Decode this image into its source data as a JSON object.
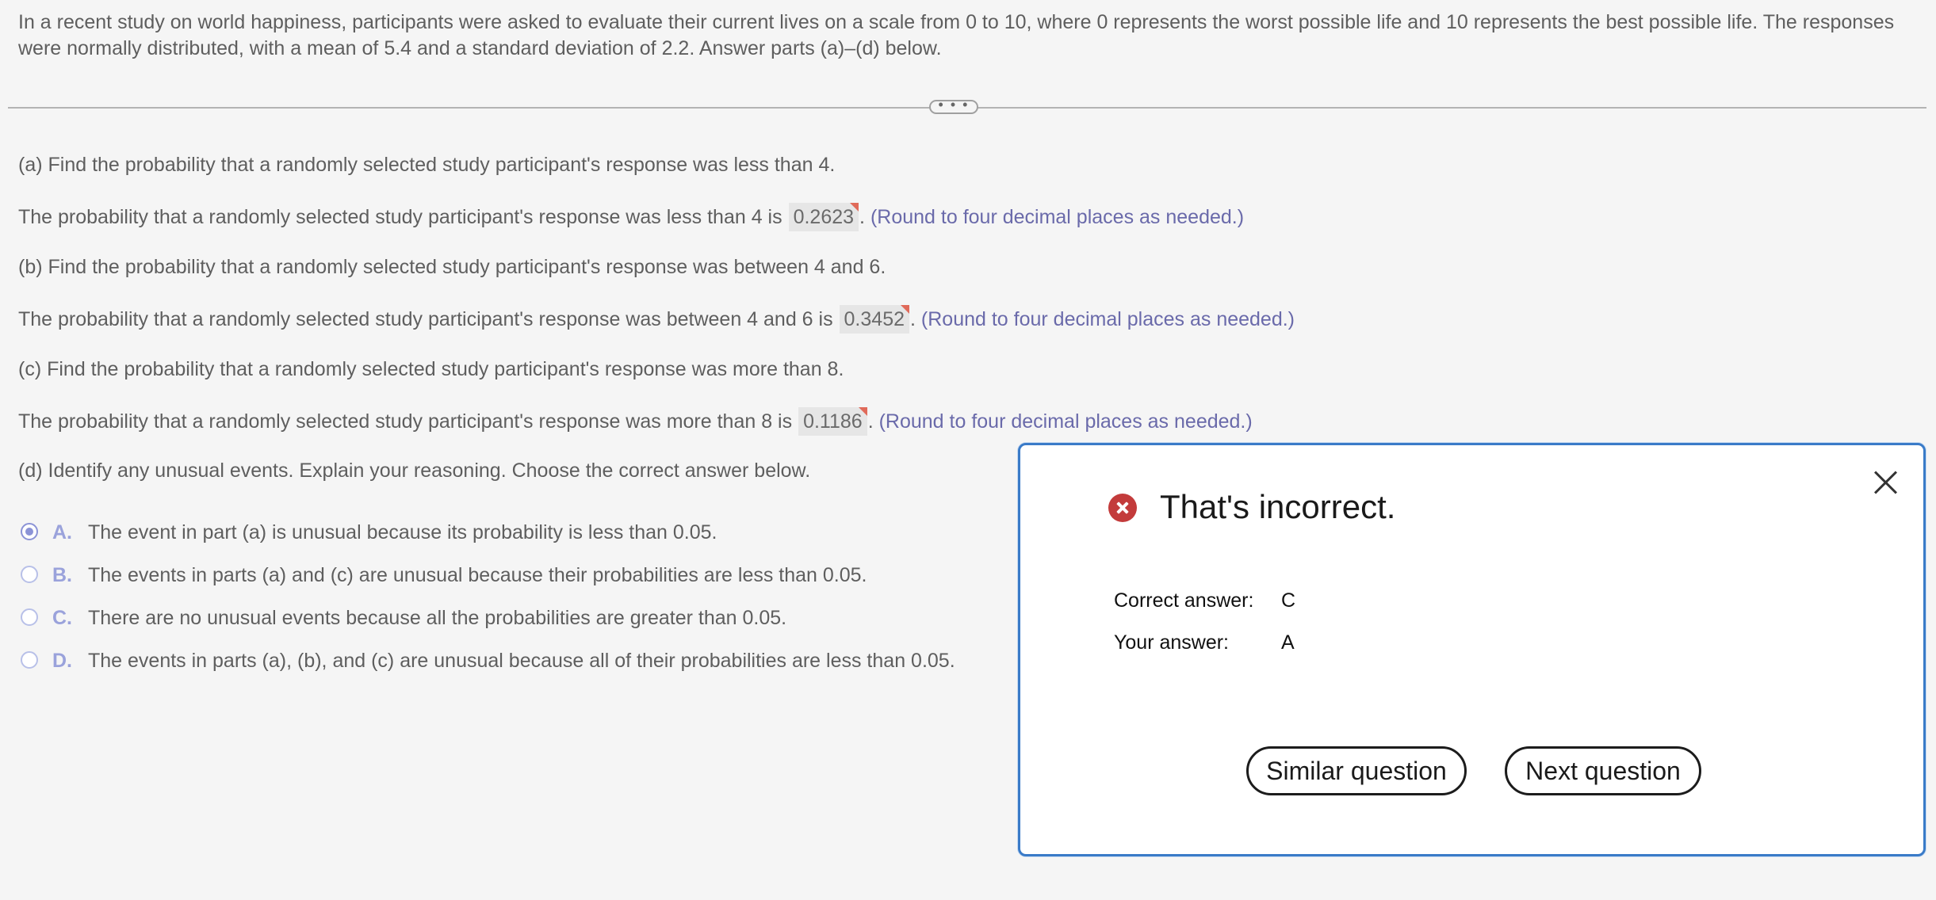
{
  "intro": "In a recent study on world happiness, participants were asked to evaluate their current lives on a scale from 0 to 10, where 0 represents the worst possible life and 10 represents the best possible life. The responses were normally distributed, with a mean of 5.4 and a standard deviation of 2.2. Answer parts (a)–(d) below.",
  "expander_label": "• • •",
  "parts": {
    "a_question": "(a) Find the probability that a randomly selected study participant's response was less than 4.",
    "a_answer_prefix": "The probability that a randomly selected study participant's response was less than 4 is",
    "a_answer_value": "0.2623",
    "b_question": "(b) Find the probability that a randomly selected study participant's response was between 4 and 6.",
    "b_answer_prefix": "The probability that a randomly selected study participant's response was between 4 and 6 is",
    "b_answer_value": "0.3452",
    "c_question": "(c) Find the probability that a randomly selected study participant's response was more than 8.",
    "c_answer_prefix": "The probability that a randomly selected study participant's response was more than 8 is",
    "c_answer_value": "0.1186",
    "d_question": "(d) Identify any unusual events. Explain your reasoning. Choose the correct answer below.",
    "period": ".",
    "round_hint": "(Round to four decimal places as needed.)"
  },
  "choices": [
    {
      "letter": "A.",
      "text": "The event in part (a) is unusual because its probability is less than 0.05.",
      "selected": true
    },
    {
      "letter": "B.",
      "text": "The events in parts (a) and (c) are unusual because their probabilities are less than 0.05.",
      "selected": false
    },
    {
      "letter": "C.",
      "text": "There are no unusual events because all the probabilities are greater than 0.05.",
      "selected": false
    },
    {
      "letter": "D.",
      "text": "The events in parts (a), (b), and (c) are unusual because all of their probabilities are less than 0.05.",
      "selected": false
    }
  ],
  "feedback": {
    "title": "That's incorrect.",
    "correct_label": "Correct answer:",
    "correct_value": "C",
    "your_label": "Your answer:",
    "your_value": "A",
    "similar_button": "Similar question",
    "next_button": "Next question",
    "status_icon": "error-circle-x-icon",
    "close_icon": "close-x-icon",
    "border_color": "#3a7bc8",
    "error_color": "#c33b3b"
  }
}
